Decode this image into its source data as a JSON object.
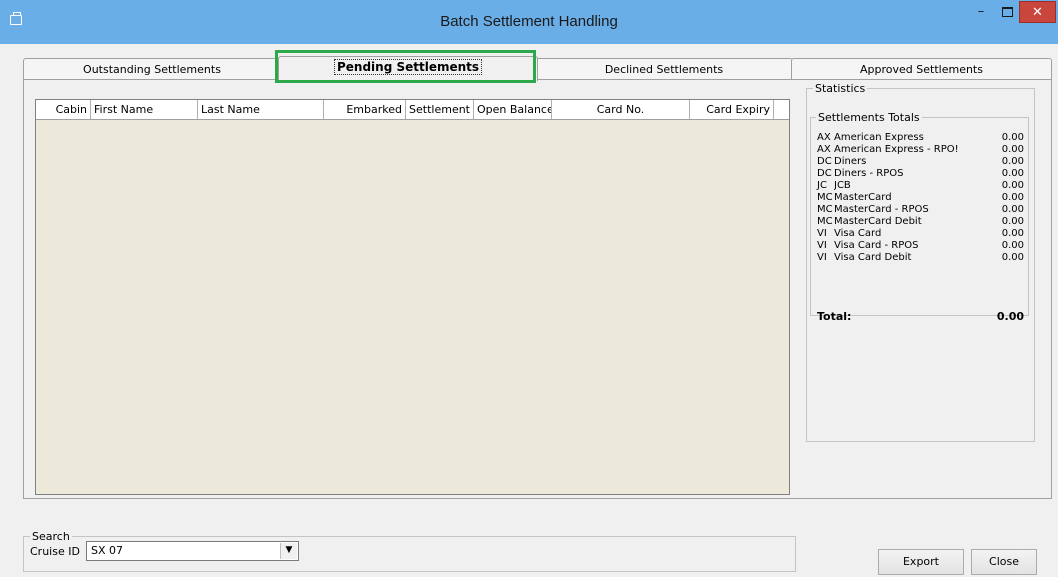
{
  "window": {
    "title": "Batch Settlement Handling",
    "minimize": "–",
    "close": "✕"
  },
  "tabs": [
    {
      "label": "Outstanding Settlements"
    },
    {
      "label": "Pending Settlements"
    },
    {
      "label": "Declined Settlements"
    },
    {
      "label": "Approved Settlements"
    }
  ],
  "grid": {
    "columns": [
      "Cabin",
      "First Name",
      "Last Name",
      "Embarked",
      "Settlement",
      "Open Balance",
      "Card No.",
      "Card Expiry"
    ]
  },
  "statistics": {
    "title": "Statistics",
    "totals_title": "Settlements Totals",
    "rows": [
      {
        "code": "AX",
        "name": "American Express",
        "value": "0.00"
      },
      {
        "code": "AX",
        "name": "American Express - RPO!",
        "value": "0.00"
      },
      {
        "code": "DC",
        "name": "Diners",
        "value": "0.00"
      },
      {
        "code": "DC",
        "name": "Diners - RPOS",
        "value": "0.00"
      },
      {
        "code": "JC",
        "name": "JCB",
        "value": "0.00"
      },
      {
        "code": "MC",
        "name": "MasterCard",
        "value": "0.00"
      },
      {
        "code": "MC",
        "name": "MasterCard - RPOS",
        "value": "0.00"
      },
      {
        "code": "MC",
        "name": "MasterCard Debit",
        "value": "0.00"
      },
      {
        "code": "VI",
        "name": "Visa Card",
        "value": "0.00"
      },
      {
        "code": "VI",
        "name": "Visa Card - RPOS",
        "value": "0.00"
      },
      {
        "code": "VI",
        "name": "Visa Card Debit",
        "value": "0.00"
      }
    ],
    "total_label": "Total:",
    "total_value": "0.00"
  },
  "search": {
    "title": "Search",
    "cruise_label": "Cruise ID",
    "cruise_value": "SX 07"
  },
  "buttons": {
    "export": "Export",
    "close": "Close"
  },
  "colors": {
    "titlebar": "#6aaee7",
    "highlight": "#2aa84a",
    "grid_bg": "#ece9da",
    "close_button": "#c9463d"
  }
}
